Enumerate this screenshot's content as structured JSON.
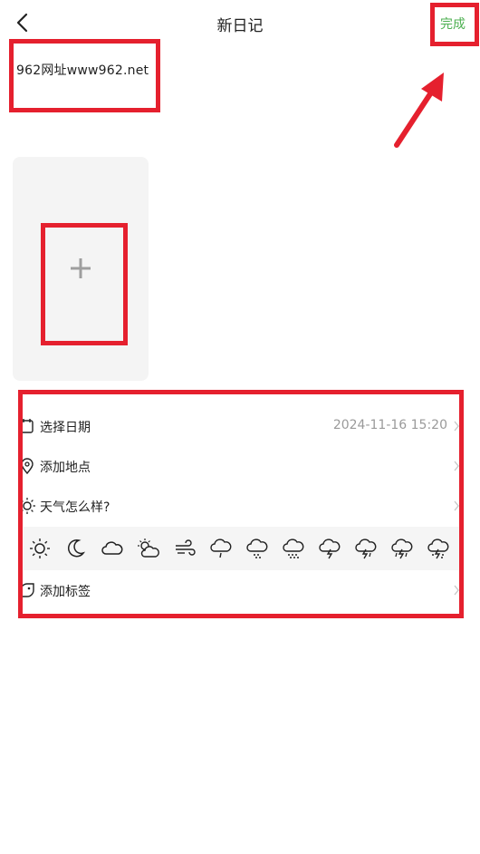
{
  "header": {
    "title": "新日记",
    "done_label": "完成",
    "done_color": "#4caf50",
    "back_icon": "back-arrow-icon"
  },
  "note": {
    "text": "962网址www962.net"
  },
  "photo": {
    "add_icon": "plus-icon"
  },
  "options": {
    "date": {
      "label": "选择日期",
      "value": "2024-11-16 15:20",
      "icon": "calendar-icon"
    },
    "location": {
      "label": "添加地点",
      "icon": "location-pin-icon"
    },
    "weather": {
      "label": "天气怎么样?",
      "icon": "sun-outline-icon"
    },
    "tag": {
      "label": "添加标签",
      "icon": "tag-icon"
    }
  },
  "weather_icons": [
    "sunny-icon",
    "moon-icon",
    "cloudy-icon",
    "partly-cloudy-icon",
    "windy-icon",
    "light-rain-icon",
    "snow-icon",
    "heavy-snow-icon",
    "thunder-icon",
    "thunderstorm-icon",
    "storm-icon",
    "sleet-icon"
  ],
  "annotation_color": "#e5202e"
}
